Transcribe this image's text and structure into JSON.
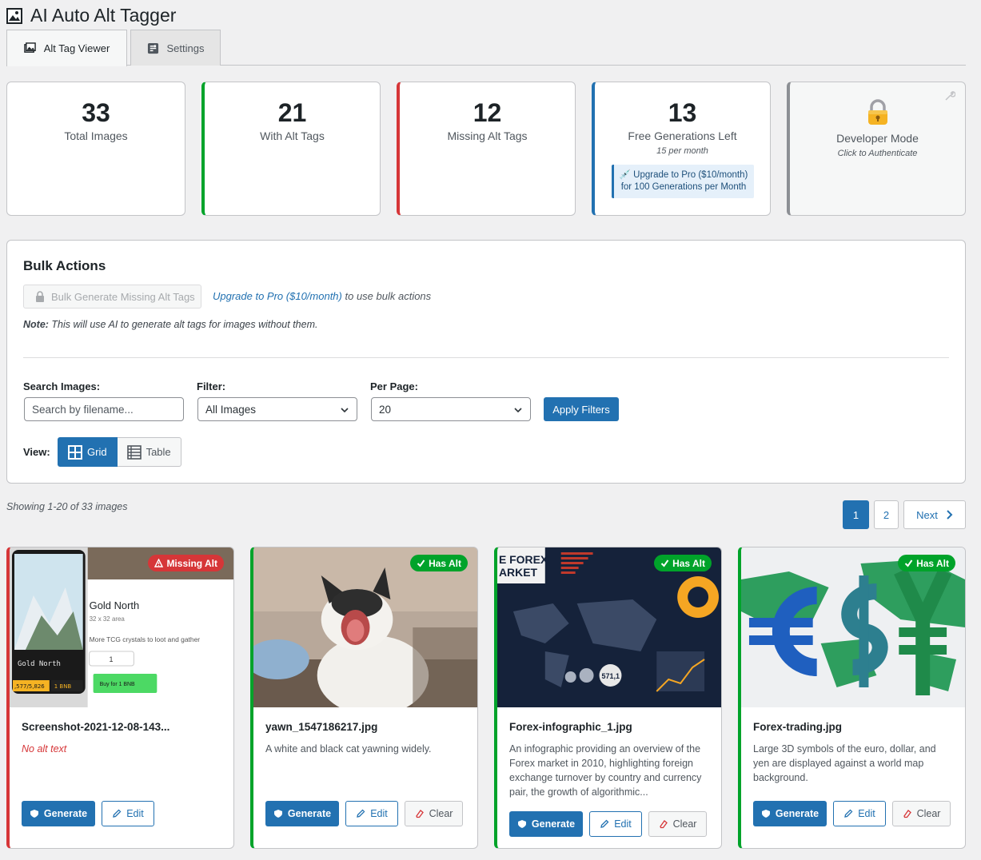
{
  "app": {
    "title": "AI Auto Alt Tagger"
  },
  "tabs": [
    {
      "label": "Alt Tag Viewer",
      "active": true
    },
    {
      "label": "Settings",
      "active": false
    }
  ],
  "stats": {
    "total": {
      "value": "33",
      "label": "Total Images"
    },
    "with_alt": {
      "value": "21",
      "label": "With Alt Tags"
    },
    "missing": {
      "value": "12",
      "label": "Missing Alt Tags"
    },
    "free": {
      "value": "13",
      "label": "Free Generations Left",
      "sub": "15 per month",
      "upgrade": "💉 Upgrade to Pro ($10/month) for 100 Generations per Month"
    },
    "dev": {
      "label": "Developer Mode",
      "sub": "Click to Authenticate"
    }
  },
  "bulk": {
    "heading": "Bulk Actions",
    "button_label": "Bulk Generate Missing Alt Tags",
    "upgrade_link": "Upgrade to Pro ($10/month)",
    "upgrade_suffix": " to use bulk actions",
    "note_label": "Note:",
    "note_text": " This will use AI to generate alt tags for images without them."
  },
  "filters": {
    "search_label": "Search Images:",
    "search_placeholder": "Search by filename...",
    "filter_label": "Filter:",
    "filter_value": "All Images",
    "per_page_label": "Per Page:",
    "per_page_value": "20",
    "apply_label": "Apply Filters",
    "view_label": "View:",
    "view_grid": "Grid",
    "view_table": "Table"
  },
  "listing": {
    "showing": "Showing 1-20 of 33 images",
    "pages": [
      "1",
      "2"
    ],
    "next": "Next"
  },
  "cards": [
    {
      "badge": "Missing Alt",
      "filename": "Screenshot-2021-12-08-143...",
      "alt": "No alt text",
      "generate": "Generate",
      "edit": "Edit",
      "thumb": {
        "title": "Gold North",
        "size": "32 x 32 area",
        "desc": "More TCG crystals to loot and gather",
        "qty": "1",
        "card_name": "Gold North",
        "price1": ",577/5,826",
        "price2": "1 BNB",
        "buy": "Buy for 1 BNB"
      }
    },
    {
      "badge": "Has Alt",
      "filename": "yawn_1547186217.jpg",
      "alt": "A white and black cat yawning widely.",
      "generate": "Generate",
      "edit": "Edit",
      "clear": "Clear"
    },
    {
      "badge": "Has Alt",
      "filename": "Forex-infographic_1.jpg",
      "alt": "An infographic providing an overview of the Forex market in 2010, highlighting foreign exchange turnover by country and currency pair, the growth of algorithmic...",
      "generate": "Generate",
      "edit": "Edit",
      "clear": "Clear",
      "thumb": {
        "line1": "E FOREX",
        "line2": "ARKET",
        "num": "571,1"
      }
    },
    {
      "badge": "Has Alt",
      "filename": "Forex-trading.jpg",
      "alt": "Large 3D symbols of the euro, dollar, and yen are displayed against a world map background.",
      "generate": "Generate",
      "edit": "Edit",
      "clear": "Clear"
    }
  ],
  "colors": {
    "primary": "#2271b1",
    "success": "#00a32a",
    "danger": "#d63638",
    "background": "#f0f0f1"
  },
  "icons": [
    "image-icon",
    "settings-icon",
    "lock-icon",
    "wrench-icon",
    "padlock-icon",
    "chevron-down-icon",
    "grid-icon",
    "table-icon",
    "chevron-right-icon",
    "shield-icon",
    "pencil-icon",
    "eraser-icon",
    "warning-icon",
    "check-icon"
  ]
}
